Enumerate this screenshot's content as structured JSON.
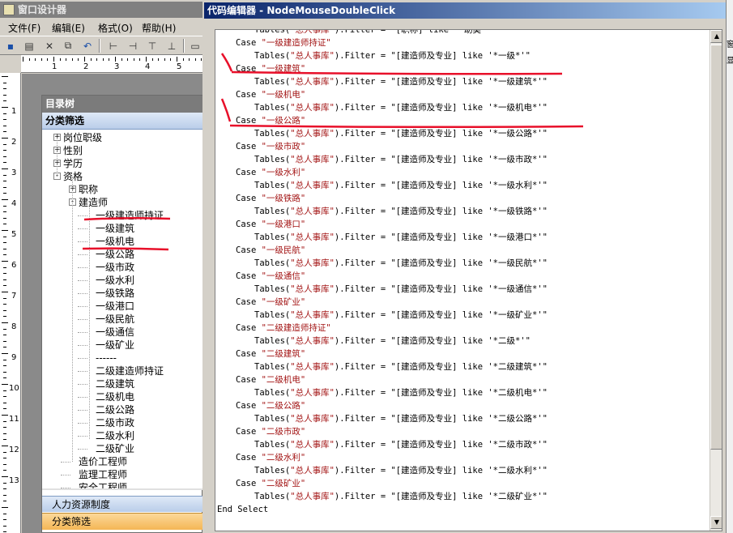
{
  "designer": {
    "title": "窗口设计器",
    "menu": [
      "文件(F)",
      "编辑(E)",
      "格式(O)",
      "帮助(H)"
    ],
    "ruler_h": [
      "1",
      "2",
      "3",
      "4",
      "5"
    ],
    "ruler_v": [
      "1",
      "2",
      "3",
      "4",
      "5",
      "6",
      "7",
      "8",
      "9",
      "10",
      "11",
      "12",
      "13"
    ]
  },
  "tree_panel": {
    "title": "目录树",
    "header": "分类筛选",
    "nodes": [
      {
        "label": "岗位职级",
        "level": 0,
        "expander": "+"
      },
      {
        "label": "性别",
        "level": 0,
        "expander": "+"
      },
      {
        "label": "学历",
        "level": 0,
        "expander": "+"
      },
      {
        "label": "资格",
        "level": 0,
        "expander": "-"
      },
      {
        "label": "职称",
        "level": 1,
        "expander": "+"
      },
      {
        "label": "建造师",
        "level": 1,
        "expander": "-"
      },
      {
        "label": "一级建造师持证",
        "level": 2,
        "expander": ""
      },
      {
        "label": "一级建筑",
        "level": 2,
        "expander": ""
      },
      {
        "label": "一级机电",
        "level": 2,
        "expander": ""
      },
      {
        "label": "一级公路",
        "level": 2,
        "expander": ""
      },
      {
        "label": "一级市政",
        "level": 2,
        "expander": ""
      },
      {
        "label": "一级水利",
        "level": 2,
        "expander": ""
      },
      {
        "label": "一级铁路",
        "level": 2,
        "expander": ""
      },
      {
        "label": "一级港口",
        "level": 2,
        "expander": ""
      },
      {
        "label": "一级民航",
        "level": 2,
        "expander": ""
      },
      {
        "label": "一级通信",
        "level": 2,
        "expander": ""
      },
      {
        "label": "一级矿业",
        "level": 2,
        "expander": ""
      },
      {
        "label": "------",
        "level": 2,
        "expander": ""
      },
      {
        "label": "二级建造师持证",
        "level": 2,
        "expander": ""
      },
      {
        "label": "二级建筑",
        "level": 2,
        "expander": ""
      },
      {
        "label": "二级机电",
        "level": 2,
        "expander": ""
      },
      {
        "label": "二级公路",
        "level": 2,
        "expander": ""
      },
      {
        "label": "二级市政",
        "level": 2,
        "expander": ""
      },
      {
        "label": "二级水利",
        "level": 2,
        "expander": ""
      },
      {
        "label": "二级矿业",
        "level": 2,
        "expander": ""
      },
      {
        "label": "造价工程师",
        "level": 1,
        "expander": ""
      },
      {
        "label": "监理工程师",
        "level": 1,
        "expander": ""
      },
      {
        "label": "安全工程师",
        "level": 1,
        "expander": ""
      }
    ],
    "tabs": [
      "人力资源制度",
      "分类筛选"
    ]
  },
  "editor": {
    "title": "代码编辑器 - NodeMouseDoubleClick",
    "side_chars": [
      "窗",
      "显"
    ],
    "lines": [
      {
        "indent": 2,
        "kw": "Tables(",
        "str": "\"总人事库\"",
        "rest": ").Filter = \"[职称] like '*助类*'\""
      },
      {
        "indent": 1,
        "kw": "Case ",
        "str": "\"一级建造师持证\"",
        "rest": ""
      },
      {
        "indent": 2,
        "kw": "Tables(",
        "str": "\"总人事库\"",
        "rest": ").Filter = \"[建造师及专业] like '*一级*'\""
      },
      {
        "indent": 1,
        "kw": "Case ",
        "str": "\"一级建筑\"",
        "rest": ""
      },
      {
        "indent": 2,
        "kw": "Tables(",
        "str": "\"总人事库\"",
        "rest": ").Filter = \"[建造师及专业] like '*一级建筑*'\""
      },
      {
        "indent": 1,
        "kw": "Case ",
        "str": "\"一级机电\"",
        "rest": ""
      },
      {
        "indent": 2,
        "kw": "Tables(",
        "str": "\"总人事库\"",
        "rest": ").Filter = \"[建造师及专业] like '*一级机电*'\""
      },
      {
        "indent": 1,
        "kw": "Case ",
        "str": "\"一级公路\"",
        "rest": ""
      },
      {
        "indent": 2,
        "kw": "Tables(",
        "str": "\"总人事库\"",
        "rest": ").Filter = \"[建造师及专业] like '*一级公路*'\""
      },
      {
        "indent": 1,
        "kw": "Case ",
        "str": "\"一级市政\"",
        "rest": ""
      },
      {
        "indent": 2,
        "kw": "Tables(",
        "str": "\"总人事库\"",
        "rest": ").Filter = \"[建造师及专业] like '*一级市政*'\""
      },
      {
        "indent": 1,
        "kw": "Case ",
        "str": "\"一级水利\"",
        "rest": ""
      },
      {
        "indent": 2,
        "kw": "Tables(",
        "str": "\"总人事库\"",
        "rest": ").Filter = \"[建造师及专业] like '*一级水利*'\""
      },
      {
        "indent": 1,
        "kw": "Case ",
        "str": "\"一级铁路\"",
        "rest": ""
      },
      {
        "indent": 2,
        "kw": "Tables(",
        "str": "\"总人事库\"",
        "rest": ").Filter = \"[建造师及专业] like '*一级铁路*'\""
      },
      {
        "indent": 1,
        "kw": "Case ",
        "str": "\"一级港口\"",
        "rest": ""
      },
      {
        "indent": 2,
        "kw": "Tables(",
        "str": "\"总人事库\"",
        "rest": ").Filter = \"[建造师及专业] like '*一级港口*'\""
      },
      {
        "indent": 1,
        "kw": "Case ",
        "str": "\"一级民航\"",
        "rest": ""
      },
      {
        "indent": 2,
        "kw": "Tables(",
        "str": "\"总人事库\"",
        "rest": ").Filter = \"[建造师及专业] like '*一级民航*'\""
      },
      {
        "indent": 1,
        "kw": "Case ",
        "str": "\"一级通信\"",
        "rest": ""
      },
      {
        "indent": 2,
        "kw": "Tables(",
        "str": "\"总人事库\"",
        "rest": ").Filter = \"[建造师及专业] like '*一级通信*'\""
      },
      {
        "indent": 1,
        "kw": "Case ",
        "str": "\"一级矿业\"",
        "rest": ""
      },
      {
        "indent": 2,
        "kw": "Tables(",
        "str": "\"总人事库\"",
        "rest": ").Filter = \"[建造师及专业] like '*一级矿业*'\""
      },
      {
        "indent": 1,
        "kw": "Case ",
        "str": "\"二级建造师持证\"",
        "rest": ""
      },
      {
        "indent": 2,
        "kw": "Tables(",
        "str": "\"总人事库\"",
        "rest": ").Filter = \"[建造师及专业] like '*二级*'\""
      },
      {
        "indent": 1,
        "kw": "Case ",
        "str": "\"二级建筑\"",
        "rest": ""
      },
      {
        "indent": 2,
        "kw": "Tables(",
        "str": "\"总人事库\"",
        "rest": ").Filter = \"[建造师及专业] like '*二级建筑*'\""
      },
      {
        "indent": 1,
        "kw": "Case ",
        "str": "\"二级机电\"",
        "rest": ""
      },
      {
        "indent": 2,
        "kw": "Tables(",
        "str": "\"总人事库\"",
        "rest": ").Filter = \"[建造师及专业] like '*二级机电*'\""
      },
      {
        "indent": 1,
        "kw": "Case ",
        "str": "\"二级公路\"",
        "rest": ""
      },
      {
        "indent": 2,
        "kw": "Tables(",
        "str": "\"总人事库\"",
        "rest": ").Filter = \"[建造师及专业] like '*二级公路*'\""
      },
      {
        "indent": 1,
        "kw": "Case ",
        "str": "\"二级市政\"",
        "rest": ""
      },
      {
        "indent": 2,
        "kw": "Tables(",
        "str": "\"总人事库\"",
        "rest": ").Filter = \"[建造师及专业] like '*二级市政*'\""
      },
      {
        "indent": 1,
        "kw": "Case ",
        "str": "\"二级水利\"",
        "rest": ""
      },
      {
        "indent": 2,
        "kw": "Tables(",
        "str": "\"总人事库\"",
        "rest": ").Filter = \"[建造师及专业] like '*二级水利*'\""
      },
      {
        "indent": 1,
        "kw": "Case ",
        "str": "\"二级矿业\"",
        "rest": ""
      },
      {
        "indent": 2,
        "kw": "Tables(",
        "str": "\"总人事库\"",
        "rest": ").Filter = \"[建造师及专业] like '*二级矿业*'\""
      },
      {
        "indent": 0,
        "kw": "End Select",
        "str": "",
        "rest": ""
      }
    ]
  },
  "colors": {
    "code_string": "#a31515",
    "annotation": "#e8102a",
    "title_active": "#0a246a",
    "tab_selected": "#f4b655"
  }
}
